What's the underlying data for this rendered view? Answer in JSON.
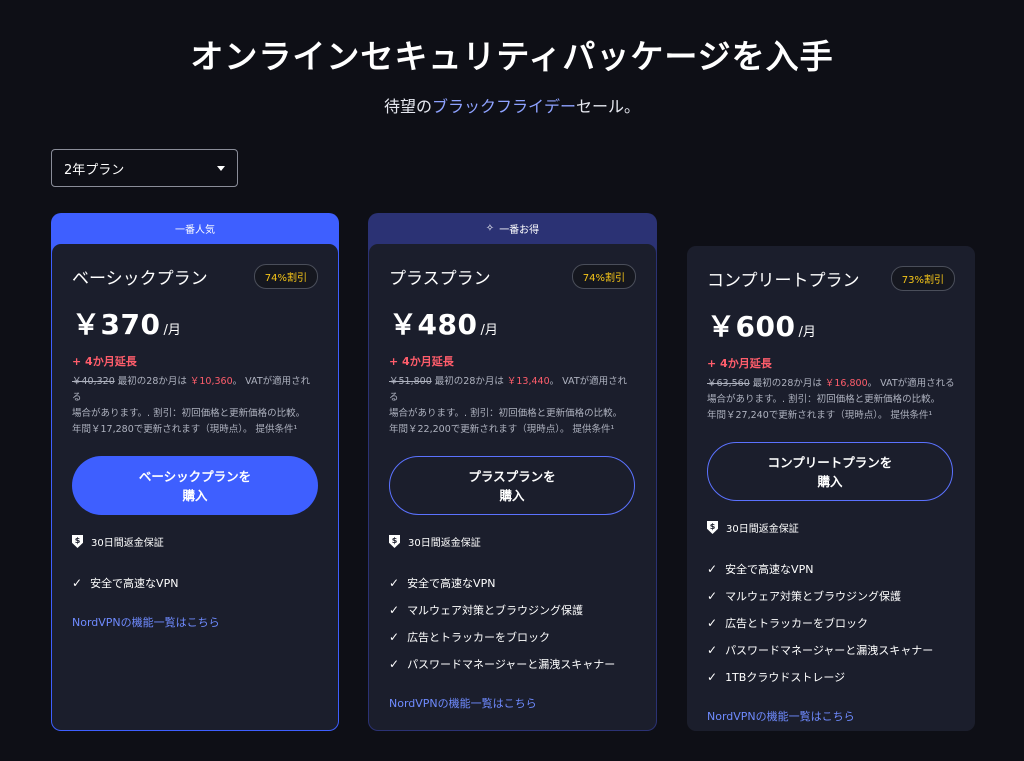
{
  "header": {
    "title": "オンラインセキュリティパッケージを入手",
    "subtitle_pre": "待望の",
    "subtitle_highlight": "ブラックフライデー",
    "subtitle_post": "セール。"
  },
  "plan_select": {
    "value": "2年プラン"
  },
  "colors": {
    "accent": "#3e5fff",
    "discount": "#f5c518",
    "extend": "#ff5d6b",
    "link": "#6f8bff",
    "background": "#0e0f16",
    "card": "#1b1e2c"
  },
  "plans": [
    {
      "banner": "一番人気",
      "name": "ベーシックプラン",
      "discount": "74%割引",
      "price": "￥370",
      "unit": "/月",
      "extend": "+ 4か月延長",
      "old_price": "￥40,320",
      "fine_mid": " 最初の28か月は ",
      "first_price": "￥10,360",
      "fine_rest1": "。 VATが適用される",
      "fine_line2": "場合があります。. 割引：初回価格と更新価格の比較。",
      "fine_line3": "年間￥17,280で更新されます（現時点）。 提供条件¹",
      "buy_line1": "ベーシックプランを",
      "buy_line2": "購入",
      "guarantee": "30日間返金保証",
      "features": [
        "安全で高速なVPN"
      ],
      "link": "NordVPNの機能一覧はこちら"
    },
    {
      "banner": "一番お得",
      "name": "プラスプラン",
      "discount": "74%割引",
      "price": "￥480",
      "unit": "/月",
      "extend": "+ 4か月延長",
      "old_price": "￥51,800",
      "fine_mid": " 最初の28か月は ",
      "first_price": "￥13,440",
      "fine_rest1": "。 VATが適用される",
      "fine_line2": "場合があります。. 割引：初回価格と更新価格の比較。",
      "fine_line3": "年間￥22,200で更新されます（現時点）。 提供条件¹",
      "buy_line1": "プラスプランを",
      "buy_line2": "購入",
      "guarantee": "30日間返金保証",
      "features": [
        "安全で高速なVPN",
        "マルウェア対策とブラウジング保護",
        "広告とトラッカーをブロック",
        "パスワードマネージャーと漏洩スキャナー"
      ],
      "link": "NordVPNの機能一覧はこちら"
    },
    {
      "name": "コンプリートプラン",
      "discount": "73%割引",
      "price": "￥600",
      "unit": "/月",
      "extend": "+ 4か月延長",
      "old_price": "￥63,560",
      "fine_mid": " 最初の28か月は ",
      "first_price": "￥16,800",
      "fine_rest1": "。 VATが適用される",
      "fine_line2": "場合があります。. 割引：初回価格と更新価格の比較。",
      "fine_line3": "年間￥27,240で更新されます（現時点）。 提供条件¹",
      "buy_line1": "コンプリートプランを",
      "buy_line2": "購入",
      "guarantee": "30日間返金保証",
      "features": [
        "安全で高速なVPN",
        "マルウェア対策とブラウジング保護",
        "広告とトラッカーをブロック",
        "パスワードマネージャーと漏洩スキャナー",
        "1TBクラウドストレージ"
      ],
      "link": "NordVPNの機能一覧はこちら"
    }
  ]
}
